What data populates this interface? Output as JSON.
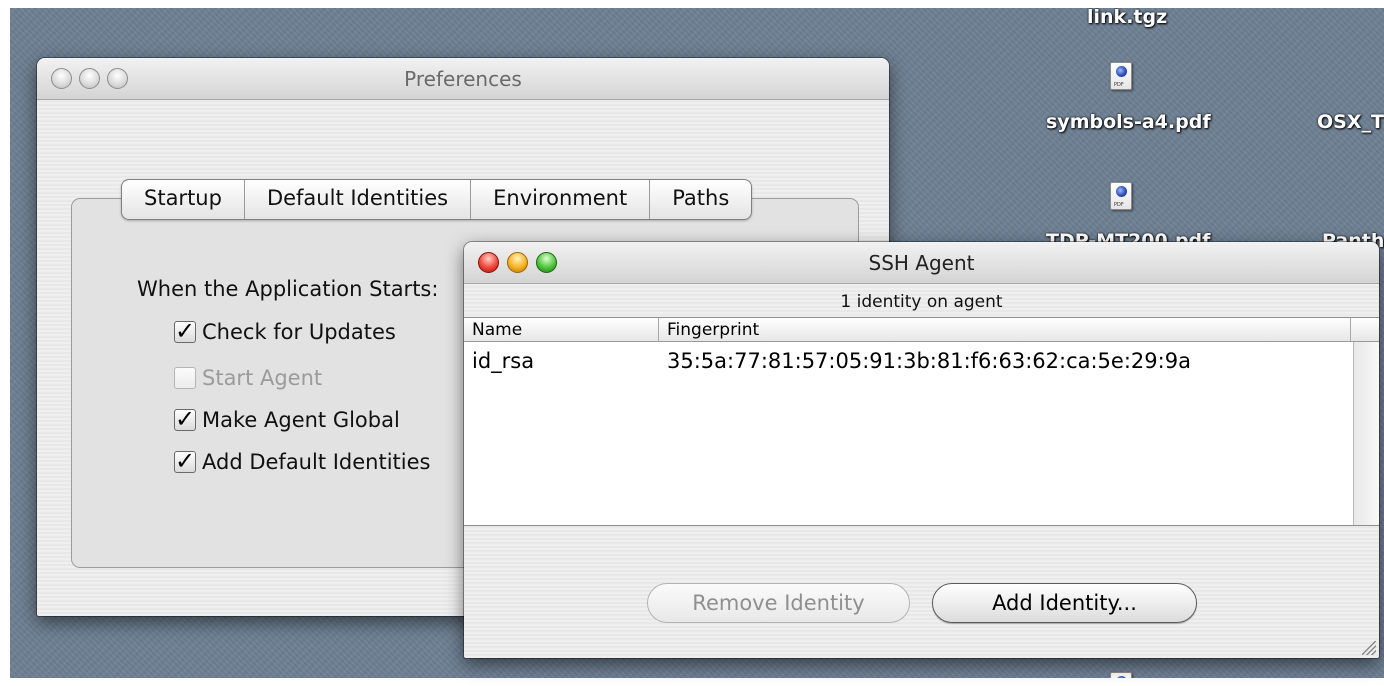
{
  "desktop": {
    "icons": [
      {
        "label": "link.tgz"
      },
      {
        "label": "symbols-a4.pdf"
      },
      {
        "label": "OSX_T"
      },
      {
        "label": "TDP-MT200.pdf"
      },
      {
        "label": "Panth"
      }
    ]
  },
  "preferences": {
    "title": "Preferences",
    "tabs": [
      "Startup",
      "Default Identities",
      "Environment",
      "Paths"
    ],
    "heading": "When the Application Starts:",
    "options": [
      {
        "label": "Check for Updates",
        "checked": true,
        "enabled": true
      },
      {
        "label": "Start Agent",
        "checked": false,
        "enabled": false
      },
      {
        "label": "Make Agent Global",
        "checked": true,
        "enabled": true
      },
      {
        "label": "Add Default Identities",
        "checked": true,
        "enabled": true
      }
    ]
  },
  "ssh_agent": {
    "title": "SSH Agent",
    "status": "1 identity on agent",
    "columns": [
      "Name",
      "Fingerprint"
    ],
    "rows": [
      {
        "name": "id_rsa",
        "fingerprint": "35:5a:77:81:57:05:91:3b:81:f6:63:62:ca:5e:29:9a"
      }
    ],
    "buttons": {
      "remove": "Remove Identity",
      "add": "Add Identity..."
    }
  }
}
